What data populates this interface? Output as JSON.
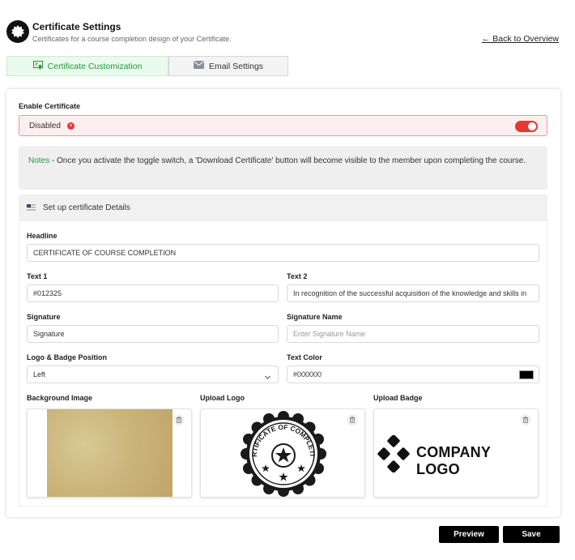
{
  "header": {
    "title": "Certificate Settings",
    "subtitle": "Certificates for a course completion design of your Certificate.",
    "back_link": "← Back to Overview"
  },
  "tabs": [
    {
      "label": "Certificate Customization",
      "icon": "certificate-icon",
      "active": true
    },
    {
      "label": "Email Settings",
      "icon": "envelope-icon",
      "active": false
    }
  ],
  "enable": {
    "label": "Enable Certificate",
    "status": "Disabled",
    "status_icon": "close-circle-icon",
    "toggle_on": false,
    "toggle_color": "#e53935"
  },
  "notes": {
    "label": "Notes",
    "text": " - Once you activate the toggle switch, a 'Download Certificate' button will become visible to the member upon completing the course."
  },
  "section": {
    "title": "Set up certificate Details"
  },
  "fields": {
    "headline": {
      "label": "Headline",
      "value": "CERTIFICATE OF COURSE COMPLETION"
    },
    "text1": {
      "label": "Text 1",
      "value": "#012325"
    },
    "text2": {
      "label": "Text 2",
      "value": "In recognition of the successful acquisition of the knowledge and skills in"
    },
    "signature": {
      "label": "Signature",
      "value": "Signature"
    },
    "signature_name": {
      "label": "Signature Name",
      "value": "",
      "placeholder": "Enter Signature Name"
    },
    "logo_position": {
      "label": "Logo & Badge Position",
      "value": "Left"
    },
    "text_color": {
      "label": "Text Color",
      "value": "#000000",
      "swatch": "#000000"
    }
  },
  "uploads": {
    "background": {
      "label": "Background Image"
    },
    "logo": {
      "label": "Upload Logo",
      "badge_text": "CERTIFICATE OF COMPLETION"
    },
    "badge": {
      "label": "Upload Badge",
      "logo_text": "COMPANY LOGO"
    }
  },
  "actions": {
    "preview": "Preview",
    "save": "Save"
  },
  "colors": {
    "accent_green": "#1d9b3a",
    "danger_red": "#e53935"
  }
}
